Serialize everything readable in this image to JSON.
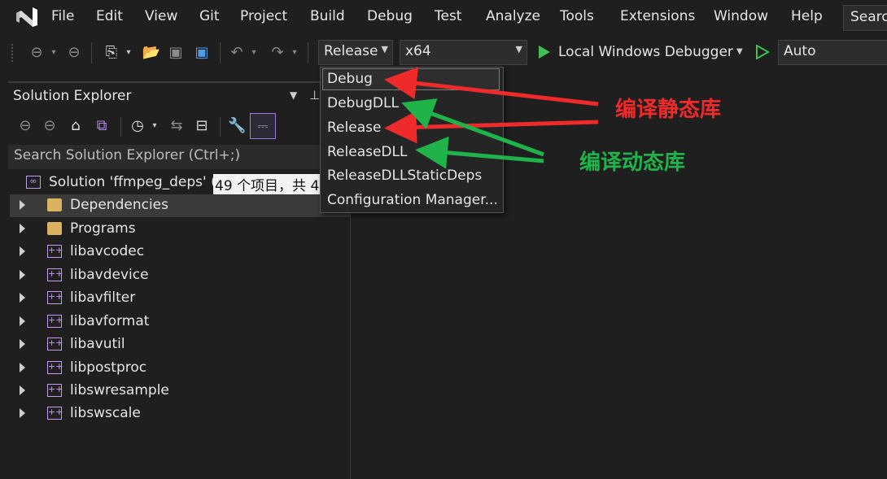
{
  "menubar": {
    "items": [
      "File",
      "Edit",
      "View",
      "Git",
      "Project",
      "Build",
      "Debug",
      "Test",
      "Analyze",
      "Tools",
      "Extensions",
      "Window",
      "Help"
    ],
    "search_label": "Search"
  },
  "toolbar": {
    "configuration": "Release",
    "platform": "x64",
    "debugger": "Local Windows Debugger",
    "run_mode": "Auto"
  },
  "solution_explorer": {
    "title": "Solution Explorer",
    "search_placeholder": "Search Solution Explorer (Ctrl+;)",
    "solution_name": "Solution 'ffmpeg_deps' (",
    "solution_count": "49 个项目，共 4",
    "items": [
      {
        "label": "Dependencies",
        "icon": "folder"
      },
      {
        "label": "Programs",
        "icon": "folder"
      },
      {
        "label": "libavcodec",
        "icon": "project"
      },
      {
        "label": "libavdevice",
        "icon": "project"
      },
      {
        "label": "libavfilter",
        "icon": "project"
      },
      {
        "label": "libavformat",
        "icon": "project"
      },
      {
        "label": "libavutil",
        "icon": "project"
      },
      {
        "label": "libpostproc",
        "icon": "project"
      },
      {
        "label": "libswresample",
        "icon": "project"
      },
      {
        "label": "libswscale",
        "icon": "project"
      }
    ]
  },
  "config_dropdown": {
    "options": [
      "Debug",
      "DebugDLL",
      "Release",
      "ReleaseDLL",
      "ReleaseDLLStaticDeps",
      "Configuration Manager..."
    ],
    "highlighted": "Debug"
  },
  "annotations": {
    "static_lib": "编译静态库",
    "dynamic_lib": "编译动态库",
    "static_color": "#ee2a2a",
    "dynamic_color": "#1fb34a"
  }
}
